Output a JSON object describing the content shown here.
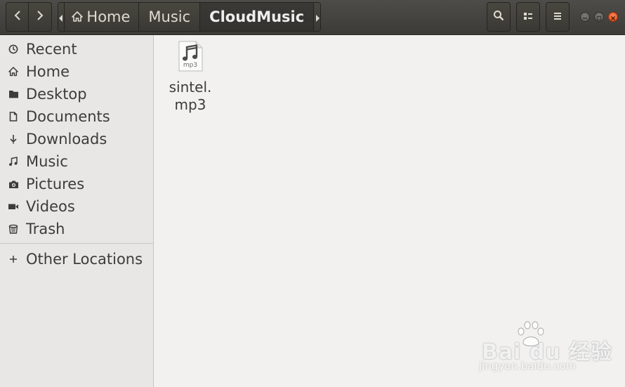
{
  "header": {
    "nav": {
      "back_icon": "chevron-left-icon",
      "forward_icon": "chevron-right-icon"
    },
    "path": {
      "crumbs": [
        {
          "label": "Home",
          "icon": "home-icon"
        },
        {
          "label": "Music"
        },
        {
          "label": "CloudMusic",
          "active": true
        }
      ]
    },
    "actions": [
      "search-icon",
      "view-toggle-icon",
      "menu-icon"
    ],
    "window_controls": [
      "minimize",
      "maximize",
      "close"
    ]
  },
  "sidebar": {
    "items": [
      {
        "label": "Recent",
        "icon": "clock-icon"
      },
      {
        "label": "Home",
        "icon": "home-icon"
      },
      {
        "label": "Desktop",
        "icon": "folder-icon"
      },
      {
        "label": "Documents",
        "icon": "document-icon"
      },
      {
        "label": "Downloads",
        "icon": "download-icon"
      },
      {
        "label": "Music",
        "icon": "music-note-icon"
      },
      {
        "label": "Pictures",
        "icon": "camera-icon"
      },
      {
        "label": "Videos",
        "icon": "video-camera-icon"
      },
      {
        "label": "Trash",
        "icon": "trash-icon"
      }
    ],
    "other_locations": {
      "label": "Other Locations",
      "icon": "plus-icon"
    }
  },
  "content": {
    "files": [
      {
        "name": "sintel.\nmp3",
        "type_label": "mp3",
        "icon": "audio-file-icon"
      }
    ]
  },
  "watermark": {
    "text": "Bai du 经验",
    "url": "jingyan.baidu.com"
  },
  "colors": {
    "header_bg": "#3c3b37",
    "sidebar_bg": "#e8e7e6",
    "content_bg": "#f2f1f0",
    "close_button": "#df4b16"
  }
}
